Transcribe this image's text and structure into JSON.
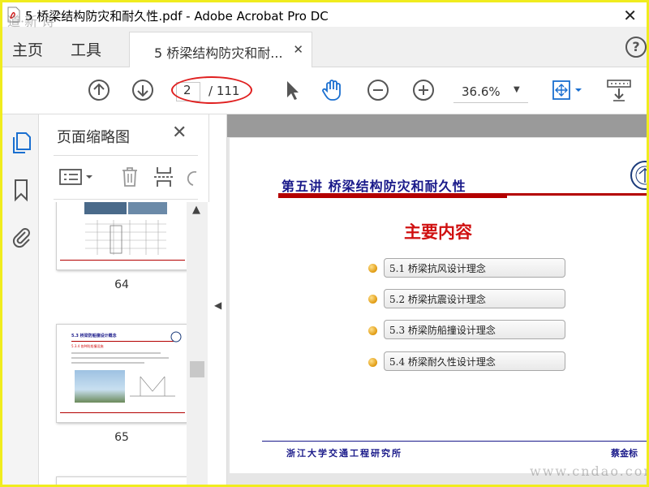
{
  "window": {
    "title": "5 桥梁结构防灾和耐久性.pdf - Adobe Acrobat Pro DC",
    "close_label": "✕"
  },
  "menu": {
    "home": "主页",
    "tools": "工具",
    "doc_tab": "5 桥梁结构防灾和耐...",
    "doc_tab_close": "✕",
    "help": "?"
  },
  "toolbar": {
    "page_current": "2",
    "page_total": "/ 111",
    "zoom": "36.6%",
    "zoom_caret": "▼"
  },
  "thumbnails": {
    "title": "页面缩略图",
    "close": "✕",
    "pages": [
      {
        "number": "64"
      },
      {
        "number": "65",
        "heading": "5.3  桥梁防船撞设计概念",
        "subheading": "5.3.4 各种防船撞设施"
      }
    ]
  },
  "document": {
    "heading": "第五讲  桥梁结构防灾和耐久性",
    "main_title": "主要内容",
    "topics": [
      "5.1 桥梁抗风设计理念",
      "5.2 桥梁抗震设计理念",
      "5.3 桥梁防船撞设计理念",
      "5.4 桥梁耐久性设计理念"
    ],
    "footer_left": "浙江大学交通工程研究所",
    "footer_right": "蔡金标"
  },
  "watermark": {
    "top_left": "道·新·诗",
    "bottom_right": "www.cndao.com"
  },
  "colors": {
    "highlight_ellipse": "#e02020",
    "heading_blue": "#1a1a8a",
    "rule_red": "#b40000",
    "title_red": "#d01010",
    "frame_yellow": "#f0ec1e"
  }
}
